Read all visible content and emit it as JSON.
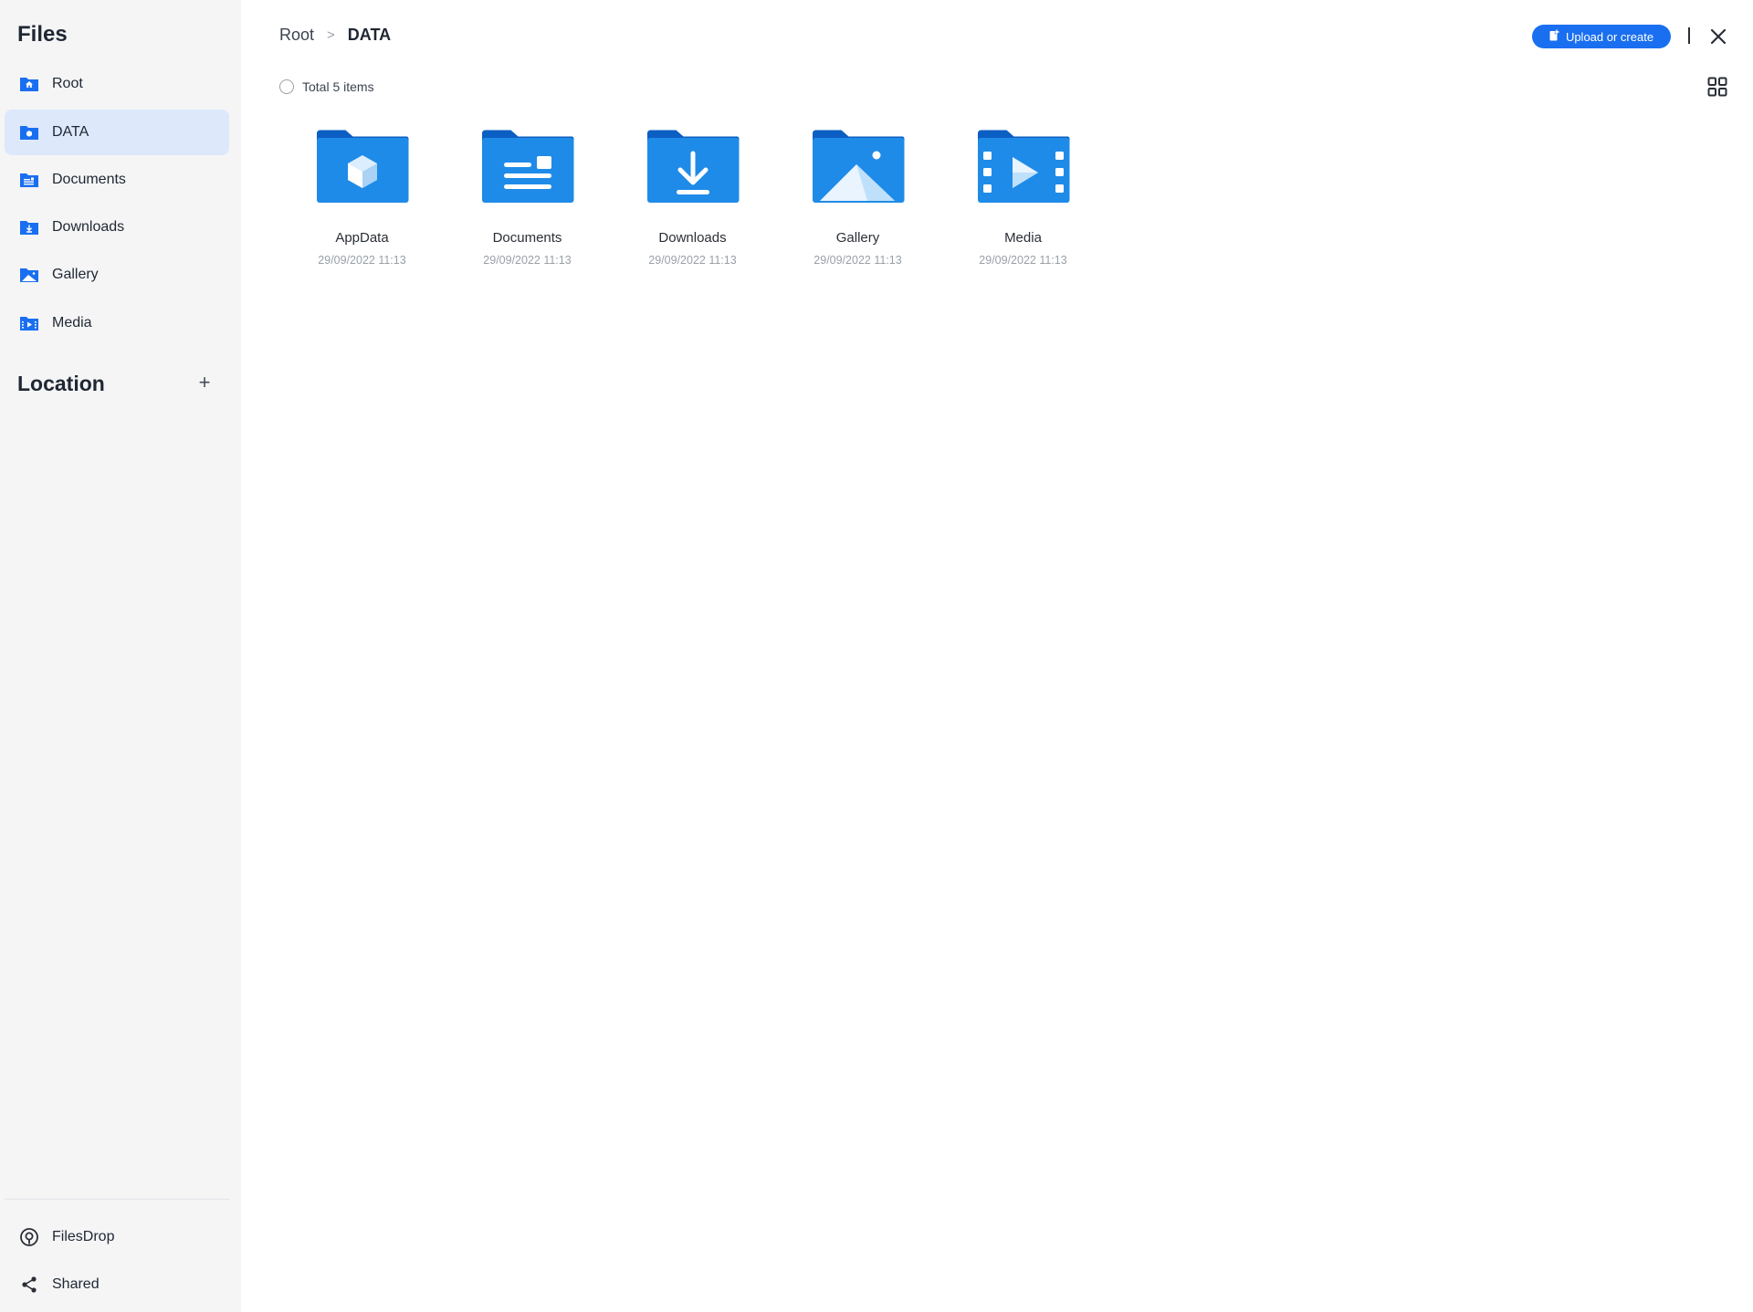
{
  "sidebar": {
    "title": "Files",
    "items": [
      {
        "label": "Root"
      },
      {
        "label": "DATA"
      },
      {
        "label": "Documents"
      },
      {
        "label": "Downloads"
      },
      {
        "label": "Gallery"
      },
      {
        "label": "Media"
      }
    ],
    "location_title": "Location",
    "location_add": "+",
    "bottom": [
      {
        "label": "FilesDrop"
      },
      {
        "label": "Shared"
      }
    ]
  },
  "header": {
    "breadcrumb": {
      "root": "Root",
      "separator": ">",
      "current": "DATA"
    },
    "upload_label": "Upload or create"
  },
  "toolbar": {
    "total_label": "Total 5 items"
  },
  "files": [
    {
      "name": "AppData",
      "date": "29/09/2022 11:13",
      "icon": "appdata-folder-icon"
    },
    {
      "name": "Documents",
      "date": "29/09/2022 11:13",
      "icon": "documents-folder-icon"
    },
    {
      "name": "Downloads",
      "date": "29/09/2022 11:13",
      "icon": "downloads-folder-icon"
    },
    {
      "name": "Gallery",
      "date": "29/09/2022 11:13",
      "icon": "gallery-folder-icon"
    },
    {
      "name": "Media",
      "date": "29/09/2022 11:13",
      "icon": "media-folder-icon"
    }
  ],
  "colors": {
    "accent": "#1a6ff0",
    "folder_back": "#0c5fc2",
    "folder_front": "#1f8be8",
    "sidebar_bg": "#f5f5f6",
    "sidebar_active": "#dde8fb"
  }
}
